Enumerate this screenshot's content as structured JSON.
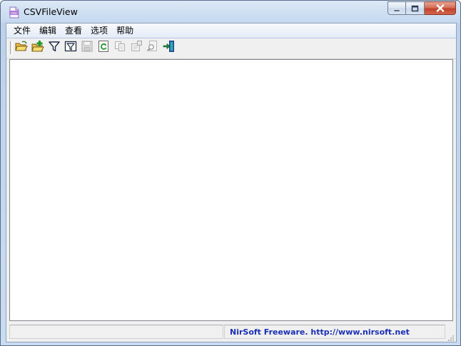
{
  "window": {
    "title": "CSVFileView",
    "app_icon": "csv-file-icon"
  },
  "caption_buttons": [
    {
      "name": "minimize-button",
      "icon": "minimize-icon"
    },
    {
      "name": "maximize-button",
      "icon": "maximize-icon"
    },
    {
      "name": "close-button",
      "icon": "close-icon"
    }
  ],
  "menu": {
    "items": [
      "文件",
      "编辑",
      "查看",
      "选项",
      "帮助"
    ]
  },
  "toolbar": {
    "buttons": [
      {
        "icon": "open-folder-icon",
        "enabled": true
      },
      {
        "icon": "open-folder-add-icon",
        "enabled": true
      },
      {
        "icon": "filter-icon",
        "enabled": true
      },
      {
        "icon": "filter-box-icon",
        "enabled": true
      },
      {
        "icon": "save-icon",
        "enabled": false
      },
      {
        "icon": "refresh-icon",
        "enabled": true
      },
      {
        "icon": "copy-icon",
        "enabled": false
      },
      {
        "icon": "properties-icon",
        "enabled": false
      },
      {
        "icon": "find-icon",
        "enabled": false
      },
      {
        "icon": "exit-icon",
        "enabled": true
      }
    ]
  },
  "statusbar": {
    "left_text": "",
    "credit": "NirSoft Freeware.  http://www.nirsoft.net"
  },
  "colors": {
    "credit_link": "#1a2fb5",
    "frame": "#c5d9ef",
    "close_button": "#c0412a"
  }
}
